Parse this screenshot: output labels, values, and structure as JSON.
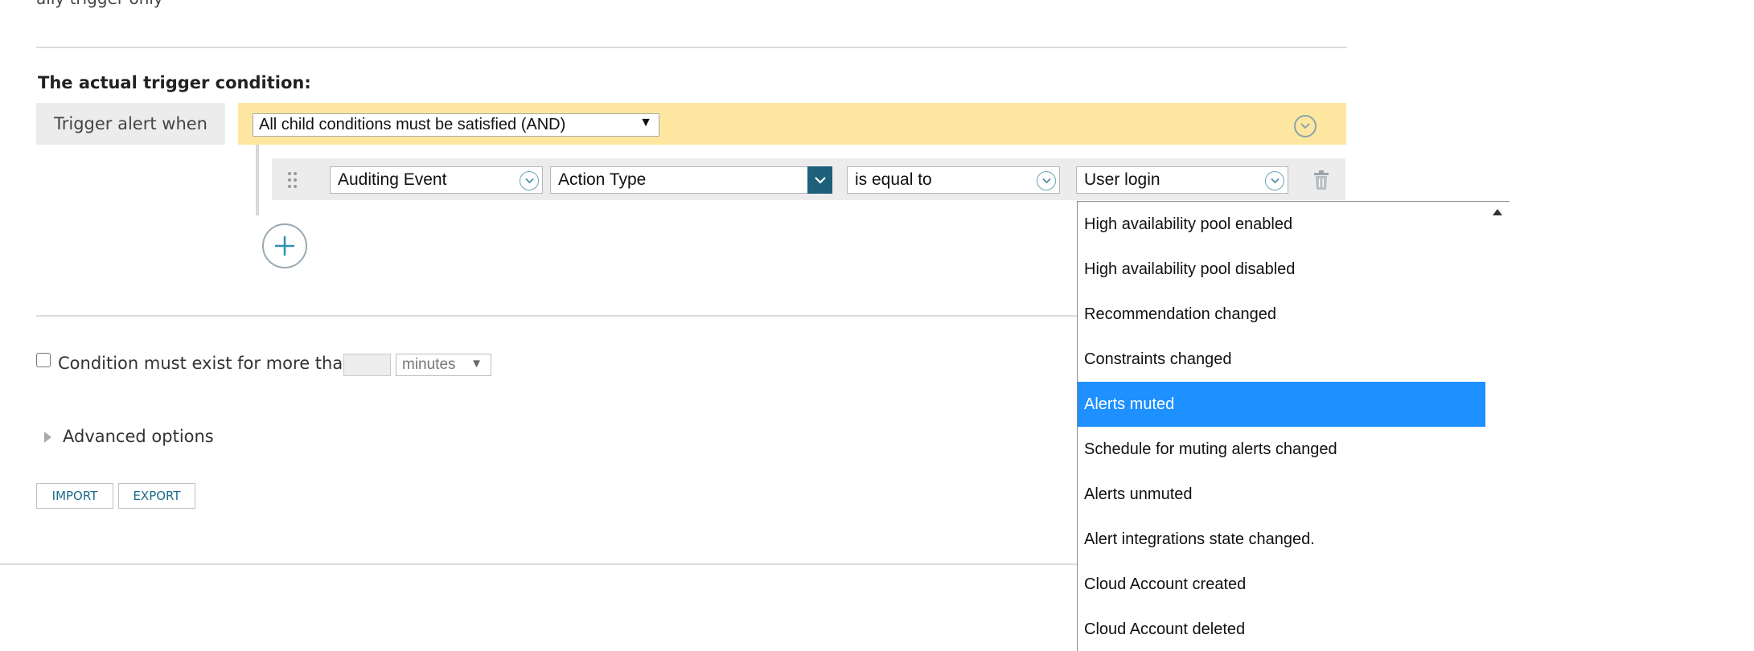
{
  "page": {
    "partial_top_text": "ally trigger only",
    "section_title": "The actual trigger condition:",
    "trigger_label": "Trigger alert when",
    "and_select_value": "All child conditions must be satisfied (AND)",
    "condition": {
      "object_value": "Auditing Event",
      "property_value": "Action Type",
      "operator_value": "is equal to",
      "value_value": "User login"
    },
    "duration": {
      "label": "Condition must exist for more than",
      "input_value": "",
      "unit_value": "minutes"
    },
    "advanced_label": "Advanced options",
    "buttons": {
      "import_label": "IMPORT",
      "export_label": "EXPORT"
    }
  },
  "dropdown": {
    "items": [
      "High availability pool enabled",
      "High availability pool disabled",
      "Recommendation changed",
      "Constraints changed",
      "Alerts muted",
      "Schedule for muting alerts changed",
      "Alerts unmuted",
      "Alert integrations state changed.",
      "Cloud Account created",
      "Cloud Account deleted"
    ],
    "selected_index": 4
  },
  "colors": {
    "accent_blue": "#1e5f7a",
    "highlight": "#1e90ff",
    "condition_yellow": "#fde7a0"
  }
}
